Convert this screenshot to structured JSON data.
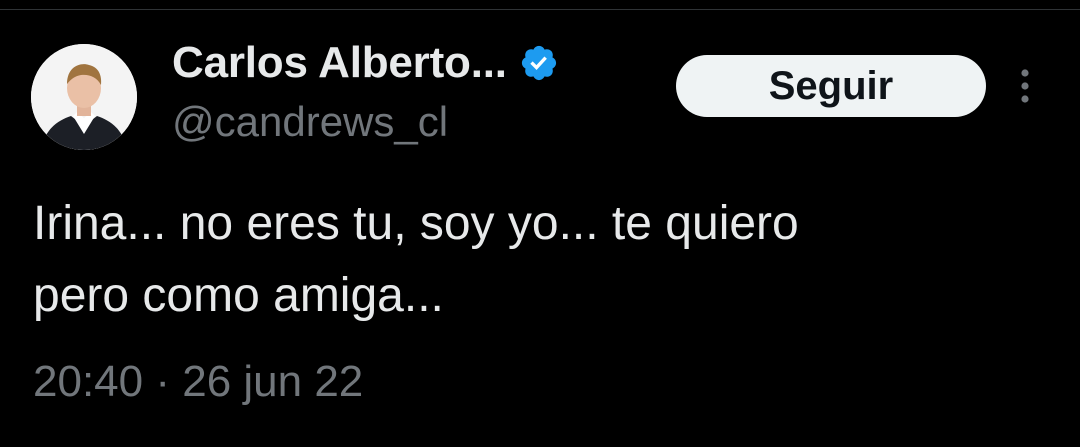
{
  "tweet": {
    "author": {
      "name": "Carlos Alberto...",
      "handle": "@candrews_cl",
      "verified": true,
      "verified_color": "#1d9bf0"
    },
    "follow_button_label": "Seguir",
    "more_icon": "more-vertical-icon",
    "text_line_1": "Irina... no eres tu, soy yo... te quiero",
    "text_line_2": "pero como amiga...",
    "time": "20:40",
    "separator": " · ",
    "date": "26 jun 22"
  },
  "colors": {
    "background": "#000000",
    "text_primary": "#e7e9ea",
    "text_secondary": "#71767b",
    "button_background": "#eff3f4",
    "button_text": "#0f1419"
  }
}
